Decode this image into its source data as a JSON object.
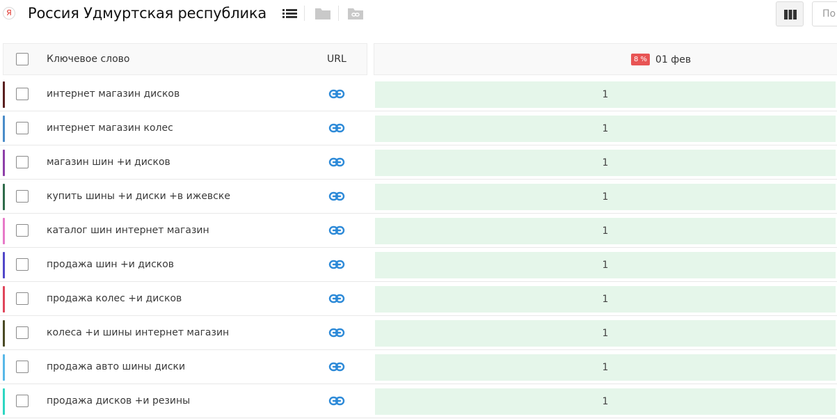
{
  "header": {
    "logo_letter": "Я",
    "title": "Россия Удмуртская республика",
    "search_placeholder": "По"
  },
  "table": {
    "columns": {
      "keyword": "Ключевое слово",
      "url": "URL",
      "date_badge": "8 %",
      "date": "01 фев"
    },
    "rows": [
      {
        "keyword": "интернет магазин дисков",
        "position": "1",
        "color": "#5a1f1f"
      },
      {
        "keyword": "интернет магазин колес",
        "position": "1",
        "color": "#4a8cc9"
      },
      {
        "keyword": "магазин шин +и дисков",
        "position": "1",
        "color": "#8e3fa8"
      },
      {
        "keyword": "купить шины +и диски +в ижевске",
        "position": "1",
        "color": "#2f6b4a"
      },
      {
        "keyword": "каталог шин интернет магазин",
        "position": "1",
        "color": "#e77ac8"
      },
      {
        "keyword": "продажа шин +и дисков",
        "position": "1",
        "color": "#5147c9"
      },
      {
        "keyword": "продажа колес +и дисков",
        "position": "1",
        "color": "#e0455a"
      },
      {
        "keyword": "колеса +и шины интернет магазин",
        "position": "1",
        "color": "#4a4a24"
      },
      {
        "keyword": "продажа авто шины диски",
        "position": "1",
        "color": "#58b8e8"
      },
      {
        "keyword": "продажа дисков +и резины",
        "position": "1",
        "color": "#2ed6c2"
      }
    ]
  },
  "colors": {
    "accent_link": "#2d8ad8",
    "badge": "#e85454",
    "position_cell": "#e5f6ea"
  }
}
